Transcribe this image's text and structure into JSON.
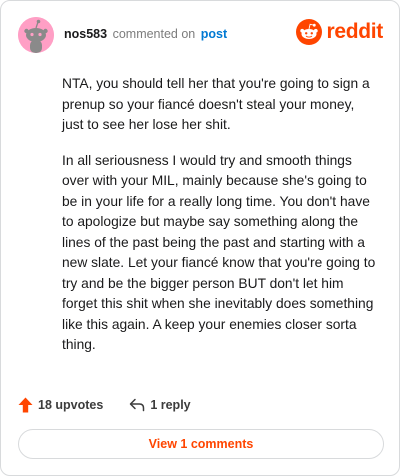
{
  "header": {
    "username": "nos583",
    "action_text": "commented on",
    "post_link": "post"
  },
  "brand": {
    "name": "reddit",
    "icon": "reddit-snoo-icon",
    "color": "#ff4500"
  },
  "comment": {
    "paragraphs": [
      "NTA, you should tell her that you're going to sign a prenup so your fiancé doesn't steal your money, just to see her lose her shit.",
      "In all seriousness I would try and smooth things over with your MIL, mainly because she's going to be in your life for a really long time. You don't have to apologize but maybe say something along the lines of the past being the past and starting with a new slate. Let your fiancé know that you're going to try and be the bigger person BUT don't let him forget this shit when she inevitably does something like this again. A keep your enemies closer sorta thing."
    ]
  },
  "actions": {
    "upvotes": "18 upvotes",
    "upvote_icon": "upvote-arrow-icon",
    "replies": "1 reply",
    "reply_icon": "reply-arrow-icon"
  },
  "footer": {
    "view_comments": "View 1 comments"
  },
  "colors": {
    "accent": "#ff4500",
    "link": "#0079d3",
    "avatar_bg": "#ff9fc5"
  }
}
